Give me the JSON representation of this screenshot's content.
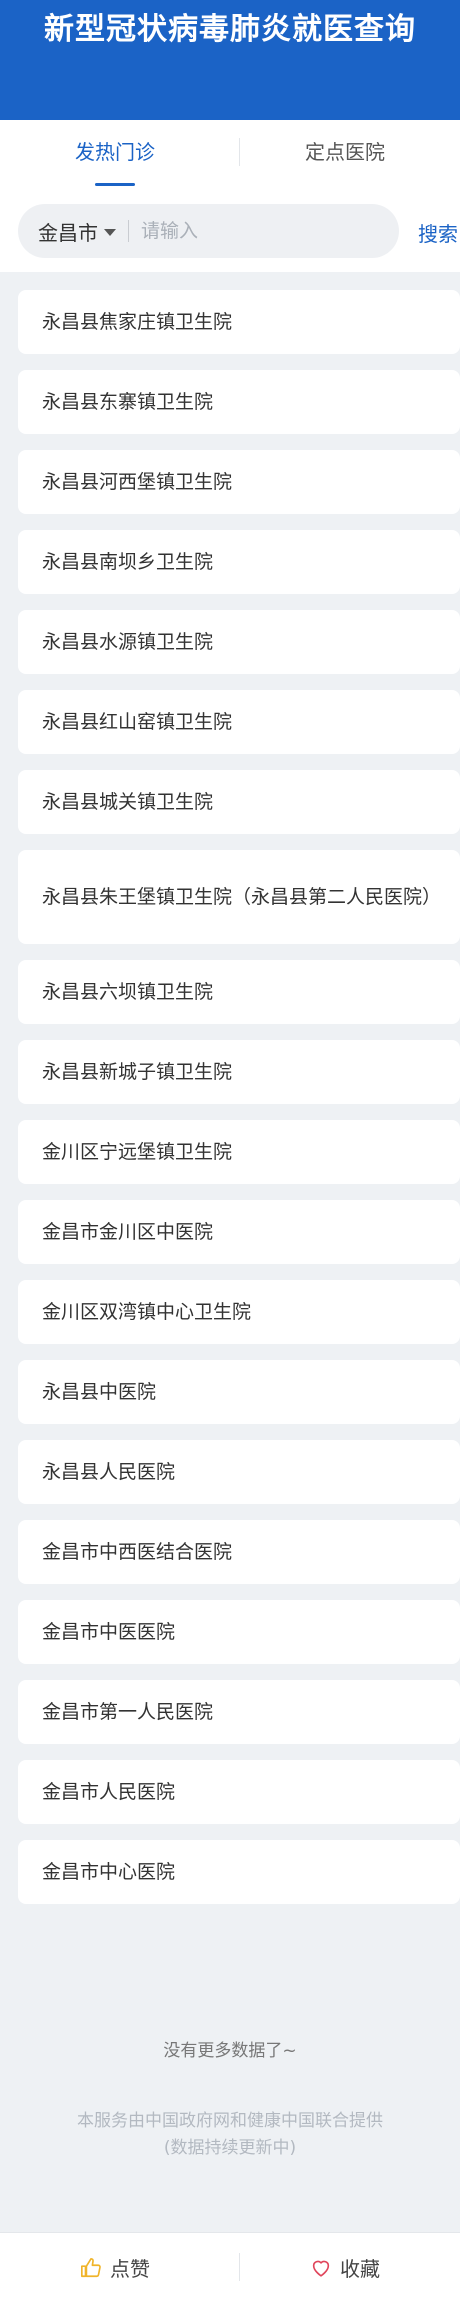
{
  "header": {
    "title": "新型冠状病毒肺炎就医查询"
  },
  "tabs": [
    {
      "label": "发热门诊"
    },
    {
      "label": "定点医院"
    }
  ],
  "search": {
    "city": "金昌市",
    "placeholder": "请输入",
    "value": "",
    "button_label": "搜索"
  },
  "hospitals": [
    "永昌县焦家庄镇卫生院",
    "永昌县东寨镇卫生院",
    "永昌县河西堡镇卫生院",
    "永昌县南坝乡卫生院",
    "永昌县水源镇卫生院",
    "永昌县红山窑镇卫生院",
    "永昌县城关镇卫生院",
    "永昌县朱王堡镇卫生院（永昌县第二人民医院）",
    "永昌县六坝镇卫生院",
    "永昌县新城子镇卫生院",
    "金川区宁远堡镇卫生院",
    "金昌市金川区中医院",
    "金川区双湾镇中心卫生院",
    "永昌县中医院",
    "永昌县人民医院",
    "金昌市中西医结合医院",
    "金昌市中医医院",
    "金昌市第一人民医院",
    "金昌市人民医院",
    "金昌市中心医院"
  ],
  "status": {
    "no_more": "没有更多数据了~",
    "service_note": "本服务由中国政府网和健康中国联合提供",
    "update_note": "(数据持续更新中)"
  },
  "bottom_bar": {
    "like_label": "点赞",
    "favorite_label": "收藏",
    "like_icon": "thumbs-up-icon",
    "favorite_icon": "heart-icon"
  },
  "colors": {
    "brand": "#1b63c6",
    "like_icon": "#f0b429",
    "favorite_icon": "#e0455b"
  }
}
